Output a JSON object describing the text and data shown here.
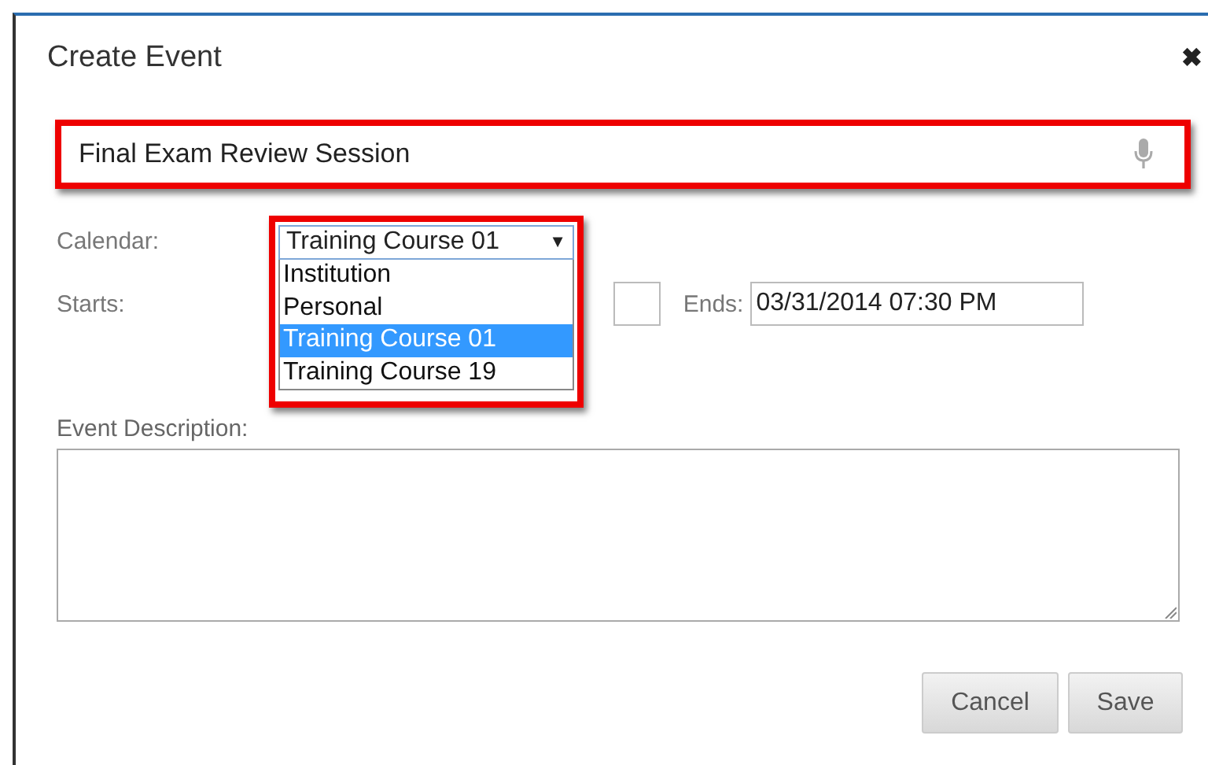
{
  "dialog": {
    "title": "Create Event",
    "close": "✖"
  },
  "title_field": {
    "value": "Final Exam Review Session"
  },
  "calendar": {
    "label": "Calendar:",
    "value": "Training Course 01",
    "caret": "▼",
    "expanded": true,
    "options": [
      {
        "label": "Institution",
        "selected": false
      },
      {
        "label": "Personal",
        "selected": false
      },
      {
        "label": "Training Course 01",
        "selected": true
      },
      {
        "label": "Training Course 19",
        "selected": false
      }
    ]
  },
  "starts": {
    "label": "Starts:"
  },
  "ends": {
    "label": "Ends:",
    "value": "03/31/2014 07:30 PM"
  },
  "description": {
    "label": "Event Description:"
  },
  "buttons": [
    "Cancel",
    "Save"
  ]
}
